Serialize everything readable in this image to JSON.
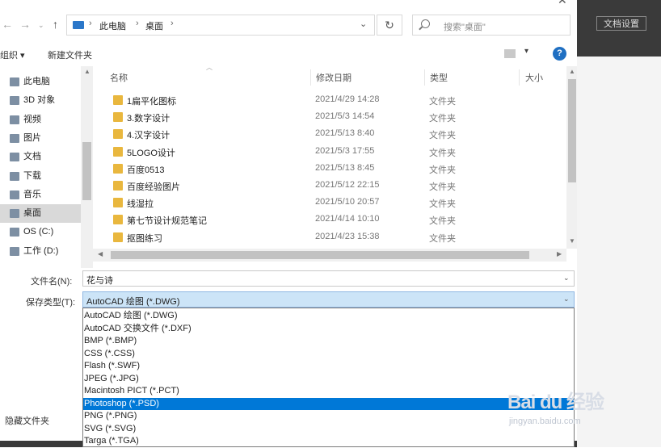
{
  "app": {
    "doc_settings_label": "文档设置"
  },
  "address": {
    "crumbs": [
      "此电脑",
      "桌面"
    ],
    "search_placeholder": "搜索\"桌面\""
  },
  "toolbar": {
    "organize_label": "组织 ▾",
    "new_folder_label": "新建文件夹",
    "help_label": "?"
  },
  "nav": {
    "items": [
      {
        "label": "此电脑",
        "icon": "computer-icon"
      },
      {
        "label": "3D 对象",
        "icon": "3d-objects-icon"
      },
      {
        "label": "视频",
        "icon": "video-icon"
      },
      {
        "label": "图片",
        "icon": "pictures-icon"
      },
      {
        "label": "文档",
        "icon": "documents-icon"
      },
      {
        "label": "下载",
        "icon": "download-icon"
      },
      {
        "label": "音乐",
        "icon": "music-icon"
      },
      {
        "label": "桌面",
        "icon": "desktop-icon",
        "selected": true
      },
      {
        "label": "OS (C:)",
        "icon": "drive-icon"
      },
      {
        "label": "工作 (D:)",
        "icon": "drive-icon"
      }
    ]
  },
  "columns": {
    "name": "名称",
    "date": "修改日期",
    "type": "类型",
    "size": "大小"
  },
  "files": [
    {
      "name": "1扁平化图标",
      "date": "2021/4/29 14:28",
      "type": "文件夹"
    },
    {
      "name": "3.数字设计",
      "date": "2021/5/3 14:54",
      "type": "文件夹"
    },
    {
      "name": "4.汉字设计",
      "date": "2021/5/13 8:40",
      "type": "文件夹"
    },
    {
      "name": "5LOGO设计",
      "date": "2021/5/3 17:55",
      "type": "文件夹"
    },
    {
      "name": "百度0513",
      "date": "2021/5/13 8:45",
      "type": "文件夹"
    },
    {
      "name": "百度经验图片",
      "date": "2021/5/12 22:15",
      "type": "文件夹"
    },
    {
      "name": "线湿拉",
      "date": "2021/5/10 20:57",
      "type": "文件夹"
    },
    {
      "name": "第七节设计规范笔记",
      "date": "2021/4/14 10:10",
      "type": "文件夹"
    },
    {
      "name": "抠图练习",
      "date": "2021/4/23 15:38",
      "type": "文件夹"
    }
  ],
  "save": {
    "filename_label": "文件名(N):",
    "filename_value": "花与诗",
    "type_label": "保存类型(T):",
    "type_value": "AutoCAD 绘图 (*.DWG)",
    "type_options": [
      "AutoCAD 绘图 (*.DWG)",
      "AutoCAD 交换文件 (*.DXF)",
      "BMP (*.BMP)",
      "CSS (*.CSS)",
      "Flash (*.SWF)",
      "JPEG (*.JPG)",
      "Macintosh PICT (*.PCT)",
      "Photoshop (*.PSD)",
      "PNG (*.PNG)",
      "SVG (*.SVG)",
      "Targa (*.TGA)"
    ],
    "highlighted_option_index": 7,
    "hide_folders_label": "隐藏文件夹"
  },
  "watermark": {
    "main": "Bai du 经验",
    "sub": "jingyan.baidu.com"
  },
  "colors": {
    "selection": "#0078d7",
    "folder": "#e9b73e",
    "help": "#1f6fc2"
  }
}
